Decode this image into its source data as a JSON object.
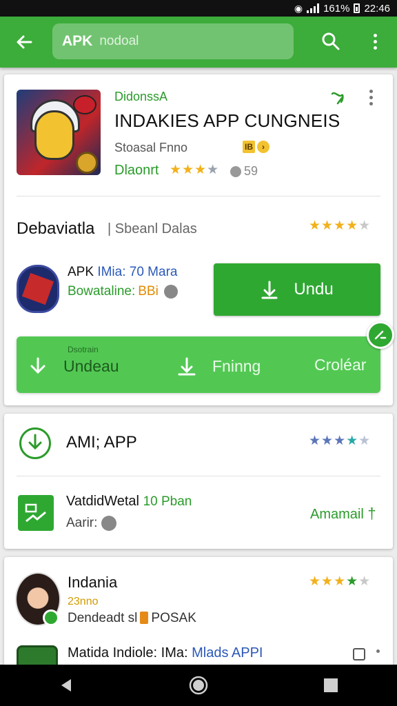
{
  "status_bar": {
    "battery": "161%",
    "time": "22:46"
  },
  "toolbar": {
    "logo": "APK",
    "search_text": "nodoal"
  },
  "featured": {
    "developer": "DidonssA",
    "title": "INDAKIES APP CUNGNEIS",
    "subtitle": "Stoasal Fnno",
    "tag": "IB",
    "discount_label": "Dlaonrt",
    "discount_stars": "★★★",
    "discount_stars_empty": "★",
    "views": "59"
  },
  "section": {
    "title": "Debaviatla",
    "subtitle": "Sbeanl Dalas",
    "stars": "★★★★",
    "stars_empty": "★"
  },
  "app_row": {
    "name": "APK",
    "meta": "IMia: 70 Mara",
    "bottom_label": "Bowataline:",
    "bottom_value": "BBi",
    "install_label": "Undu"
  },
  "action_bar": {
    "caption": "Dsotrain",
    "items": [
      "Undeau",
      "Fninng",
      "Croléar"
    ]
  },
  "card2": {
    "title": "AMI; APP",
    "stars_full": "★★★",
    "stars_teal": "★",
    "stars_empty": "★",
    "app_name": "VatdidWetal",
    "app_meta": "10 Pban",
    "app_sub": "Aarir:",
    "action": "Amamail"
  },
  "card3": {
    "name": "Indania",
    "stars_full": "★★★",
    "stars_green": "★",
    "stars_empty": "★",
    "sub": "23nno",
    "meta": "Dendeadt sl",
    "meta_tag": "POSAK",
    "app_label": "Matida Indiole: IMa:",
    "app_link": "Mlads APPI"
  }
}
